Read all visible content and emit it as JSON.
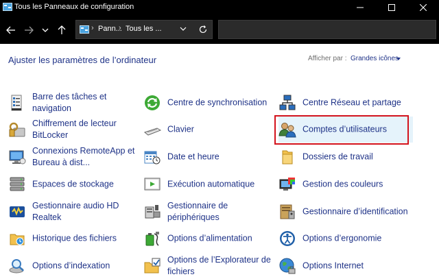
{
  "window": {
    "title": "Tous les Panneaux de configuration"
  },
  "address": {
    "crumbs": [
      "Pann...",
      "Tous les ..."
    ],
    "search_placeholder": ""
  },
  "header": {
    "title": "Ajuster les paramètres de l’ordinateur",
    "view_by_label": "Afficher par :",
    "view_by_value": "Grandes icônes"
  },
  "items": [
    {
      "label": "Barre des tâches et navigation",
      "icon": "taskbar-icon"
    },
    {
      "label": "Chiffrement de lecteur BitLocker",
      "icon": "bitlocker-icon"
    },
    {
      "label": "Connexions RemoteApp et Bureau à dist...",
      "icon": "remoteapp-icon"
    },
    {
      "label": "Espaces de stockage",
      "icon": "storage-spaces-icon"
    },
    {
      "label": "Gestionnaire audio HD Realtek",
      "icon": "realtek-audio-icon"
    },
    {
      "label": "Historique des fichiers",
      "icon": "file-history-icon"
    },
    {
      "label": "Options d’indexation",
      "icon": "indexing-icon"
    },
    {
      "label": "Centre de synchronisation",
      "icon": "sync-center-icon"
    },
    {
      "label": "Clavier",
      "icon": "keyboard-icon"
    },
    {
      "label": "Date et heure",
      "icon": "date-time-icon"
    },
    {
      "label": "Exécution automatique",
      "icon": "autoplay-icon"
    },
    {
      "label": "Gestionnaire de périphériques",
      "icon": "device-manager-icon"
    },
    {
      "label": "Options d’alimentation",
      "icon": "power-options-icon"
    },
    {
      "label": "Options de l’Explorateur de fichiers",
      "icon": "explorer-options-icon"
    },
    {
      "label": "Centre Réseau et partage",
      "icon": "network-center-icon"
    },
    {
      "label": "Comptes d’utilisateurs",
      "icon": "user-accounts-icon"
    },
    {
      "label": "Dossiers de travail",
      "icon": "work-folders-icon"
    },
    {
      "label": "Gestion des couleurs",
      "icon": "color-management-icon"
    },
    {
      "label": "Gestionnaire d’identification",
      "icon": "credential-manager-icon"
    },
    {
      "label": "Options d’ergonomie",
      "icon": "ease-of-access-icon"
    },
    {
      "label": "Options Internet",
      "icon": "internet-options-icon"
    }
  ],
  "colors": {
    "link": "#1e3287",
    "highlight_border": "#d3121c",
    "highlight_bg": "#e5f3fb"
  }
}
